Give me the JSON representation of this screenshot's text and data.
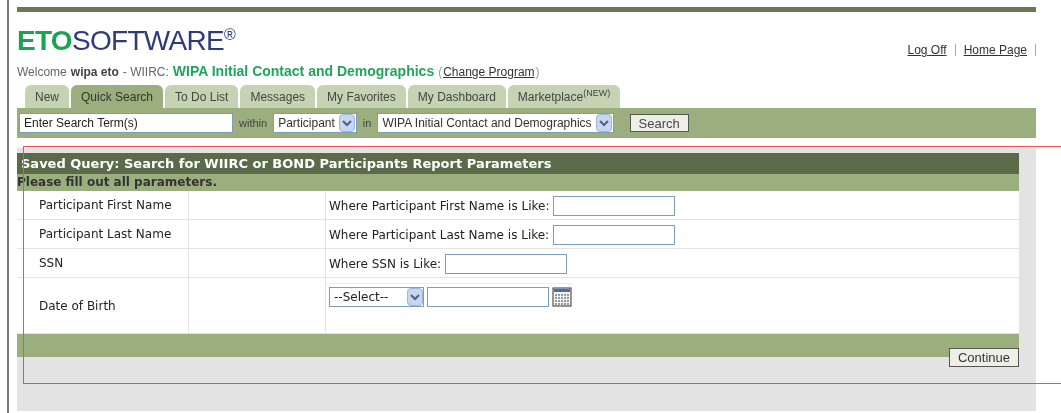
{
  "logo": {
    "part_1": "ETO",
    "part_2": "SOFTWARE",
    "mark": "®"
  },
  "top_links": [
    {
      "label": "Log Off"
    },
    {
      "label": "Home Page"
    }
  ],
  "welcome": {
    "prefix": "Welcome",
    "user": "wipa eto",
    "site": "- WIIRC:",
    "program": "WIPA Initial Contact and Demographics",
    "link": "Change Program",
    "open_paren": "(",
    "close_paren": ")"
  },
  "tabs": [
    {
      "label": "New",
      "selected": false
    },
    {
      "label": "Quick Search",
      "selected": true
    },
    {
      "label": "To Do List",
      "selected": false
    },
    {
      "label": "Messages",
      "selected": false
    },
    {
      "label": "My Favorites",
      "selected": false
    },
    {
      "label": "My Dashboard",
      "selected": false
    },
    {
      "label": "Marketplace$^{(NEW)}$",
      "selected": false
    }
  ],
  "search_bar": {
    "term": "Enter Search Term(s)",
    "within_label": "within",
    "within_value": "Participant",
    "in_label": "in",
    "in_value": "WIPA Initial Contact and Demographics",
    "button": "Search"
  },
  "panel": {
    "title": "Saved Query: Search for WIIRC or BOND Participants Report Parameters",
    "instruction": "Please fill out all parameters.",
    "rows": [
      {
        "kind": "text",
        "label": "Participant First Name",
        "condition": "Where Participant First Name is Like:"
      },
      {
        "kind": "text",
        "label": "Participant Last Name",
        "condition": "Where Participant Last Name is Like:"
      },
      {
        "kind": "short",
        "label": "SSN",
        "condition": "Where SSN is Like:"
      },
      {
        "kind": "date",
        "label": "Date of Birth",
        "select": "--Select--"
      }
    ],
    "button": "Continue"
  }
}
